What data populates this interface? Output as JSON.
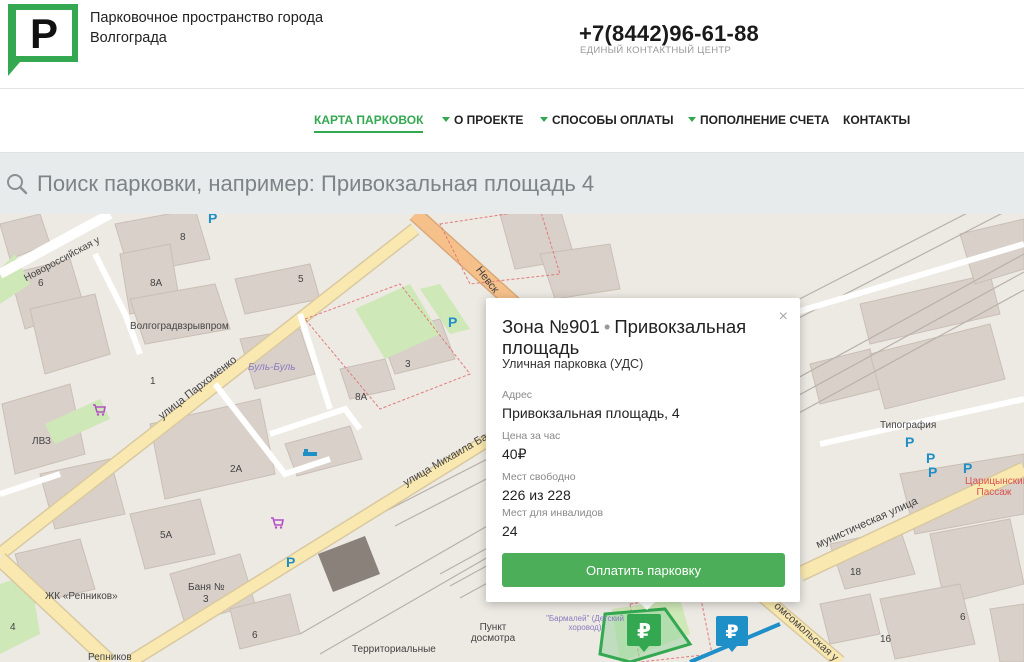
{
  "header": {
    "logo_letter": "P",
    "title": "Парковочное пространство города Волгограда",
    "phone": "+7(8442)96-61-88",
    "phone_caption": "ЕДИНЫЙ КОНТАКТНЫЙ ЦЕНТР"
  },
  "nav": {
    "items": [
      {
        "label": "КАРТА ПАРКОВОК",
        "active": true,
        "caret": false
      },
      {
        "label": "О ПРОЕКТЕ",
        "active": false,
        "caret": true
      },
      {
        "label": "СПОСОБЫ ОПЛАТЫ",
        "active": false,
        "caret": true
      },
      {
        "label": "ПОПОЛНЕНИЕ СЧЕТА",
        "active": false,
        "caret": true
      },
      {
        "label": "КОНТАКТЫ",
        "active": false,
        "caret": false
      }
    ]
  },
  "search": {
    "placeholder": "Поиск парковки, например: Привокзальная площадь 4",
    "value": ""
  },
  "map": {
    "labels": [
      "Новороссийская у",
      "Волгоградвзрывпром",
      "улица Пархоменко",
      "Буль-Буль",
      "ЛВЗ",
      "улица Михаила Ба",
      "ЖК «Репников»",
      "Баня №",
      "Репников",
      "Территориальные",
      "Пункт досмотра",
      "\"Бармалей\" (Детский хоровод)",
      "Типография",
      "мунистическая улица",
      "Царицынский Пассаж",
      "омсомольская у",
      "Невск"
    ],
    "numbers": [
      "8",
      "6",
      "8А",
      "5",
      "3",
      "8А",
      "1",
      "2А",
      "5А",
      "3",
      "6",
      "4",
      "18",
      "16",
      "6"
    ],
    "currency_marker": "₽",
    "parking_marker": "P",
    "colors": {
      "road_major": "#f9e9b0",
      "road_orange": "#f5c08a",
      "park": "#cfe8b7",
      "building": "#d9d0c9",
      "parking_blue": "#1f8fc7",
      "brand_green": "#34a851"
    }
  },
  "popup": {
    "zone": "Зона №901",
    "name": "Привокзальная площадь",
    "subtitle": "Уличная парковка (УДС)",
    "fields": [
      {
        "label": "Адрес",
        "value": "Привокзальная площадь, 4"
      },
      {
        "label": "Цена за час",
        "value": "40₽"
      },
      {
        "label": "Мест свободно",
        "value": "226 из 228"
      },
      {
        "label": "Мест для инвалидов",
        "value": "24"
      }
    ],
    "button_label": "Оплатить парковку",
    "close_symbol": "×"
  }
}
